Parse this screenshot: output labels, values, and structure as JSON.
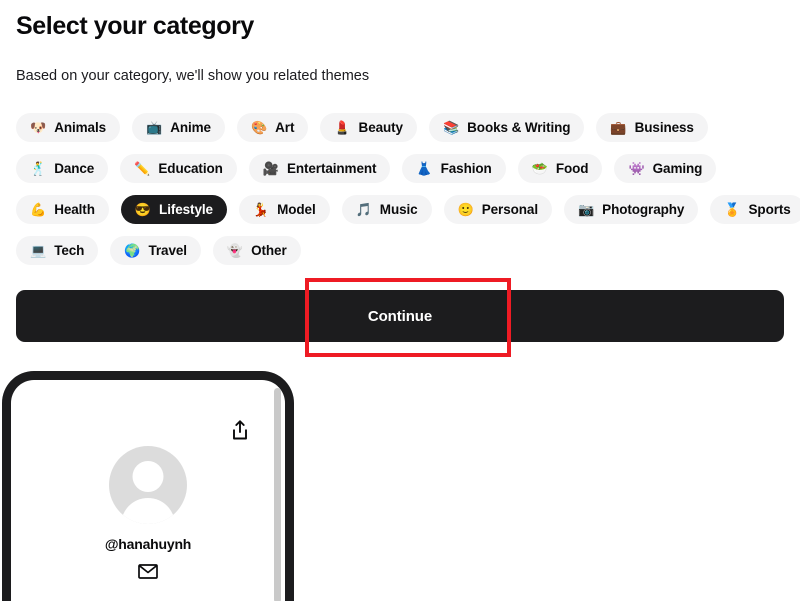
{
  "header": {
    "title": "Select your category",
    "subtitle": "Based on your category, we'll show you related themes"
  },
  "categories": {
    "rows": [
      [
        {
          "label": "Animals",
          "emoji": "🐶",
          "icon_name": "dog-face-emoji",
          "selected": false
        },
        {
          "label": "Anime",
          "emoji": "📺",
          "icon_name": "television-emoji",
          "selected": false
        },
        {
          "label": "Art",
          "emoji": "🎨",
          "icon_name": "artist-palette-emoji",
          "selected": false
        },
        {
          "label": "Beauty",
          "emoji": "💄",
          "icon_name": "lipstick-emoji",
          "selected": false
        },
        {
          "label": "Books & Writing",
          "emoji": "📚",
          "icon_name": "books-emoji",
          "selected": false
        },
        {
          "label": "Business",
          "emoji": "💼",
          "icon_name": "briefcase-emoji",
          "selected": false
        }
      ],
      [
        {
          "label": "Dance",
          "emoji": "🕺",
          "icon_name": "dancer-emoji",
          "selected": false
        },
        {
          "label": "Education",
          "emoji": "✏️",
          "icon_name": "pencil-emoji",
          "selected": false
        },
        {
          "label": "Entertainment",
          "emoji": "🎥",
          "icon_name": "movie-camera-emoji",
          "selected": false
        },
        {
          "label": "Fashion",
          "emoji": "👗",
          "icon_name": "dress-emoji",
          "selected": false
        },
        {
          "label": "Food",
          "emoji": "🥗",
          "icon_name": "salad-emoji",
          "selected": false
        },
        {
          "label": "Gaming",
          "emoji": "👾",
          "icon_name": "alien-monster-emoji",
          "selected": false
        }
      ],
      [
        {
          "label": "Health",
          "emoji": "💪",
          "icon_name": "flexed-biceps-emoji",
          "selected": false
        },
        {
          "label": "Lifestyle",
          "emoji": "😎",
          "icon_name": "smiling-face-with-sunglasses-emoji",
          "selected": true
        },
        {
          "label": "Model",
          "emoji": "💃",
          "icon_name": "dancing-woman-emoji",
          "selected": false
        },
        {
          "label": "Music",
          "emoji": "🎵",
          "icon_name": "musical-note-emoji",
          "selected": false
        },
        {
          "label": "Personal",
          "emoji": "🙂",
          "icon_name": "slightly-smiling-face-emoji",
          "selected": false
        },
        {
          "label": "Photography",
          "emoji": "📷",
          "icon_name": "camera-emoji",
          "selected": false
        },
        {
          "label": "Sports",
          "emoji": "🏅",
          "icon_name": "sports-medal-emoji",
          "selected": false
        }
      ],
      [
        {
          "label": "Tech",
          "emoji": "💻",
          "icon_name": "laptop-emoji",
          "selected": false
        },
        {
          "label": "Travel",
          "emoji": "🌍",
          "icon_name": "globe-emoji",
          "selected": false
        },
        {
          "label": "Other",
          "emoji": "👻",
          "icon_name": "ghost-emoji",
          "selected": false
        }
      ]
    ]
  },
  "actions": {
    "continue_label": "Continue"
  },
  "highlight": {
    "color": "#ee1b24"
  },
  "preview": {
    "username": "@hanahuynh",
    "share_icon_name": "share-icon",
    "mail_icon_name": "mail-icon",
    "avatar_name": "avatar-placeholder"
  }
}
